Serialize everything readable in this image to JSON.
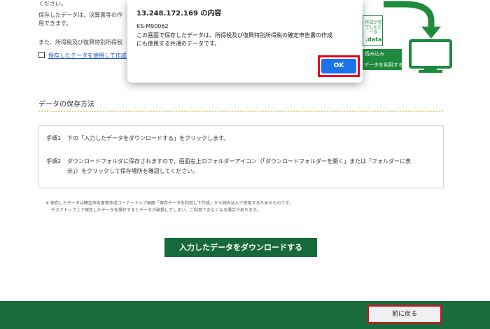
{
  "intro": {
    "line0": "ください。",
    "line1": "保存したデータは、決算書等の作",
    "line2": "用できます。",
    "line3": "また、所得税及び復興特別所得税",
    "link": "保存したデータを使用して作成"
  },
  "diagram": {
    "file_label": "作成が完了したデータ",
    "file_ext": ".data",
    "bar_line1": "読み込み",
    "bar_line2": "データを利用する"
  },
  "section": {
    "title": "データの保存方法"
  },
  "steps": [
    {
      "num": "手順1",
      "text": "下の「入力したデータをダウンロードする」をクリックします。"
    },
    {
      "num": "手順2",
      "text": "ダウンロードフォルダに保存されますので、画面右上のフォルダーアイコン（「ダウンロードフォルダーを開く」または「フォルダーに表",
      "text2": "示」）をクリックして保存場所を確認してください。"
    }
  ],
  "notes": {
    "line1": "※ 保存したデータは確定申告書等作成コーナートップ画面「保存データを利用して作成」から読み込んで使用するためのものです。",
    "line2": "デスクトップ上で保存したデータを操作するとデータが破損してしまい、ご利用できなくなる場合があります。"
  },
  "download_button": "入力したデータをダウンロードする",
  "back_button": "前に戻る",
  "dialog": {
    "title": "13.248.172.169 の内容",
    "code": "KS-M90062",
    "message_line1": "この画面で保存したデータは、所得税及び復興特別所得税の確定申告書の作成",
    "message_line2": "にも使用する共通のデータです。",
    "ok_label": "OK"
  },
  "colors": {
    "green_primary": "#17693a",
    "green_footer": "#1a6e3b",
    "green_diagram": "#1e8a3e",
    "highlight_red": "#e8001c",
    "ok_blue": "#1a73e8",
    "dotted_rule": "#f0cf7a"
  }
}
